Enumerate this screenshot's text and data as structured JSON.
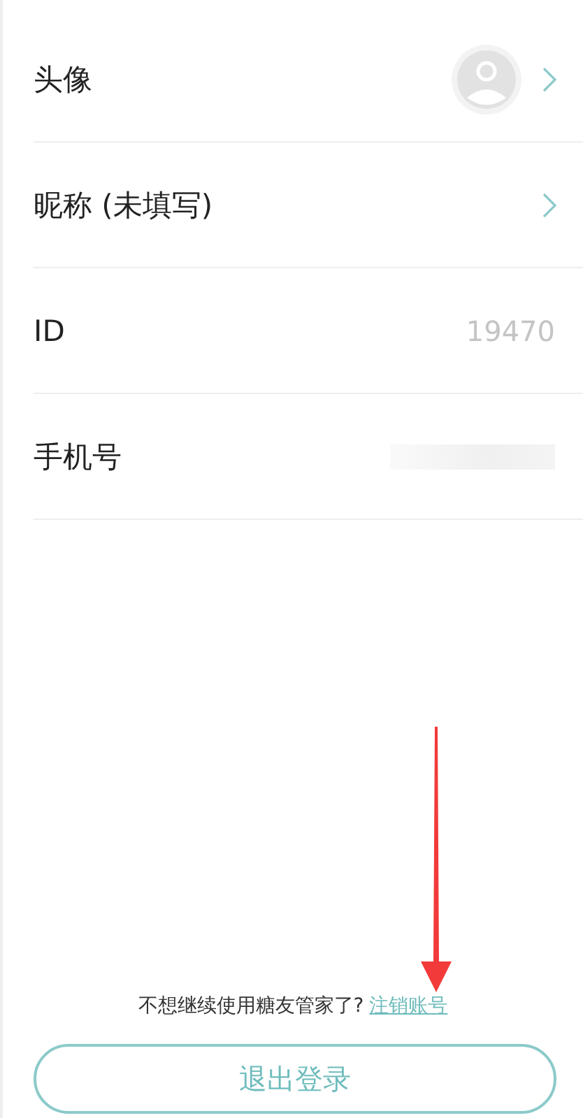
{
  "rows": [
    {
      "label": "头像",
      "kind": "avatar",
      "chevron": true
    },
    {
      "label": "昵称 (未填写)",
      "kind": "plain",
      "chevron": true
    },
    {
      "label": "ID",
      "kind": "value",
      "value": "19470",
      "chevron": false
    },
    {
      "label": "手机号",
      "kind": "redacted",
      "chevron": false
    }
  ],
  "footer": {
    "hint": "不想继续使用糖友管家了?",
    "link": "注销账号"
  },
  "logout_button": "退出登录",
  "annotation": {
    "kind": "arrow",
    "color": "#f23a3a"
  }
}
